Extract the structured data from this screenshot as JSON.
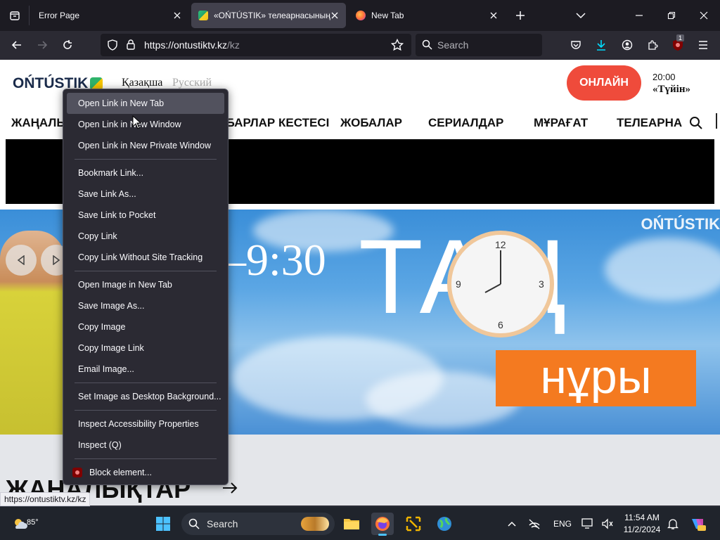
{
  "browser": {
    "tabs": [
      {
        "title": "Error Page",
        "active": false
      },
      {
        "title": "«OŃTÚSTIK» телеарнасының ресми",
        "active": true
      },
      {
        "title": "New Tab",
        "active": false
      }
    ],
    "url_host": "https://ontustiktv.kz",
    "url_path": "/kz",
    "search_placeholder": "Search",
    "notification_badge": "1",
    "status_link": "https://ontustiktv.kz/kz"
  },
  "site": {
    "logo": "OŃTÚSTIK",
    "languages": [
      "Қазақша",
      "Русский"
    ],
    "live_button": "ОНЛАЙН",
    "schedule": {
      "time": "20:00",
      "show": "«Түйін»"
    },
    "menu": [
      "ЖАҢАЛЫҚТАР",
      "ХАБАРЛАР КЕСТЕСІ",
      "ЖОБАЛАР",
      "СЕРИАЛДАР",
      "МҰРАҒАТ",
      "ТЕЛЕАРНА"
    ],
    "banner": {
      "brand": "OŃTÚSTIK",
      "time": "–9:30",
      "word_top": "ТАҢ",
      "word_bottom": "нұры",
      "clock_numbers": [
        "12",
        "3",
        "6",
        "9"
      ]
    },
    "news_heading": "ЖАҢАЛЫҚТАР"
  },
  "context_menu": {
    "groups": [
      [
        "Open Link in New Tab",
        "Open Link in New Window",
        "Open Link in New Private Window"
      ],
      [
        "Bookmark Link...",
        "Save Link As...",
        "Save Link to Pocket",
        "Copy Link",
        "Copy Link Without Site Tracking"
      ],
      [
        "Open Image in New Tab",
        "Save Image As...",
        "Copy Image",
        "Copy Image Link",
        "Email Image..."
      ],
      [
        "Set Image as Desktop Background..."
      ],
      [
        "Inspect Accessibility Properties",
        "Inspect (Q)"
      ],
      [
        "Block element..."
      ]
    ]
  },
  "taskbar": {
    "weather": "85°",
    "search_placeholder": "Search",
    "language": "ENG",
    "time": "11:54 AM",
    "date": "11/2/2024"
  },
  "colors": {
    "live_red": "#ef4b3b",
    "banner_orange": "#f47a20",
    "logo_navy": "#1a2b4a"
  }
}
